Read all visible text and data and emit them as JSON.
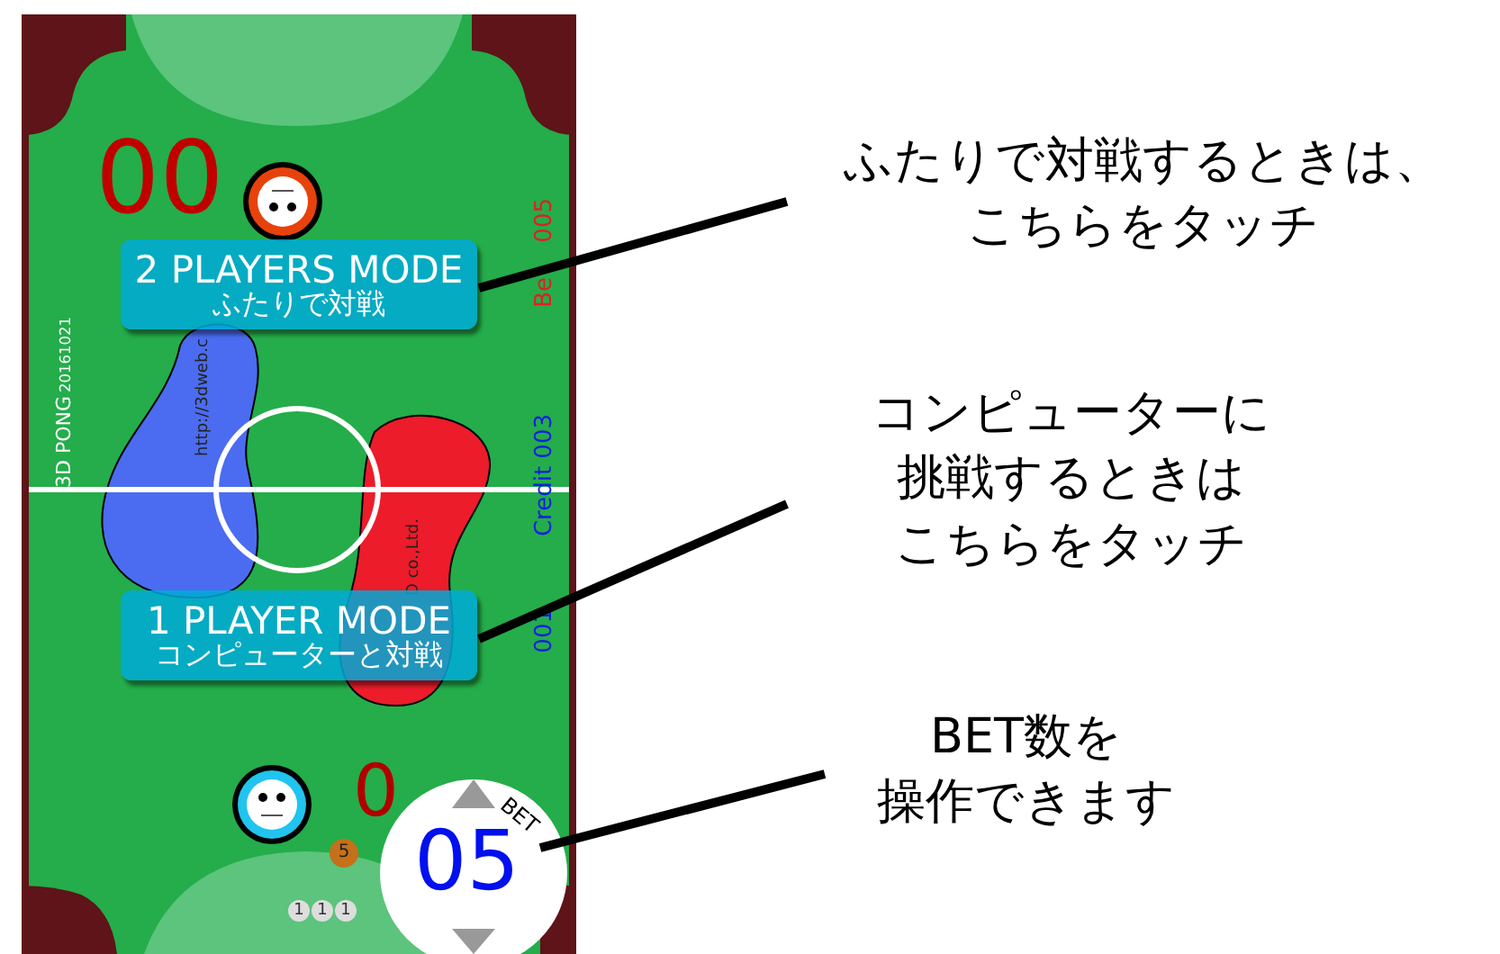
{
  "game": {
    "title": "3D PONG",
    "version": "20161021",
    "top_score": "00",
    "bottom_score": "0",
    "url_text": "http://3dweb.c",
    "company_text": "D co.,Ltd.",
    "bet": {
      "label": "Be",
      "value": "005"
    },
    "credit": {
      "label": "Credit",
      "value": "003"
    },
    "counter": "001",
    "mode_buttons": [
      {
        "title": "2 PLAYERS MODE",
        "subtitle": "ふたりで対戦"
      },
      {
        "title": "1 PLAYER MODE",
        "subtitle": "コンピューターと対戦"
      }
    ],
    "coin": "5",
    "balls": [
      "1",
      "1",
      "1"
    ],
    "bet_dial": {
      "label": "BET",
      "value": "05"
    }
  },
  "callouts": [
    {
      "lines": [
        "ふたりで対戦するときは、",
        "こちらをタッチ"
      ]
    },
    {
      "lines": [
        "コンピューターに",
        "挑戦するときは",
        "こちらをタッチ"
      ]
    },
    {
      "lines": [
        "BET数を",
        "操作できます"
      ]
    }
  ]
}
